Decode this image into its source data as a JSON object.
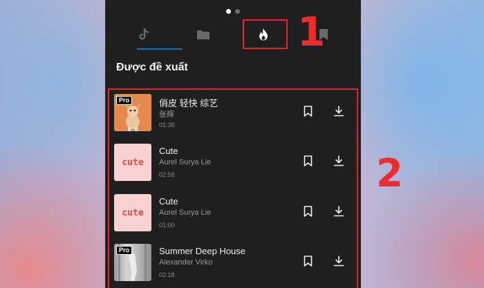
{
  "pager": {
    "pages": 2,
    "active": 0
  },
  "tabs": [
    {
      "icon": "tiktok-icon",
      "active": false
    },
    {
      "icon": "folder-icon",
      "active": false
    },
    {
      "icon": "fire-icon",
      "active": true
    },
    {
      "icon": "bookmark-icon",
      "active": false
    }
  ],
  "annotations": {
    "marker_1": "1",
    "marker_2": "2",
    "highlight_color": "#e8262a"
  },
  "section": {
    "title": "Được đề xuất"
  },
  "tracks": [
    {
      "title": "俏皮 轻快 综艺",
      "artist": "张辉",
      "duration": "01:38",
      "thumb": "dog",
      "badge": "Pro"
    },
    {
      "title": "Cute",
      "artist": "Aurel Surya Lie",
      "duration": "02:58",
      "thumb": "cute",
      "thumb_text": "cute"
    },
    {
      "title": "Cute",
      "artist": "Aurel Surya Lie",
      "duration": "01:00",
      "thumb": "cute",
      "thumb_text": "cute"
    },
    {
      "title": "Summer Deep House",
      "artist": "Alexander Virko",
      "duration": "02:18",
      "thumb": "dance",
      "badge": "Pro"
    }
  ],
  "colors": {
    "panel_bg": "#1f1f1f",
    "accent_underline": "#2e6ea6",
    "annotation_red": "#ee2c2c"
  }
}
